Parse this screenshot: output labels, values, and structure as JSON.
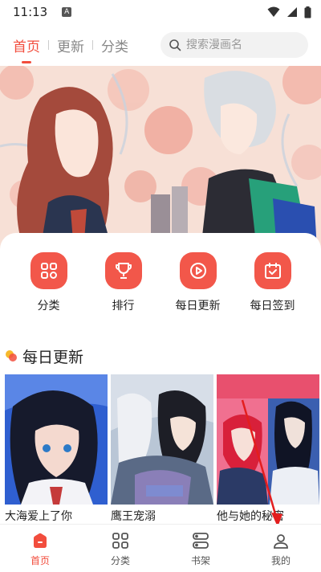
{
  "status_bar": {
    "time": "11:13",
    "notif_letter": "A"
  },
  "top_nav": {
    "tabs": [
      {
        "label": "首页",
        "active": true
      },
      {
        "label": "更新",
        "active": false
      },
      {
        "label": "分类",
        "active": false
      }
    ],
    "search_placeholder": "搜索漫画名"
  },
  "shortcuts": [
    {
      "label": "分类",
      "icon": "category-grid-icon"
    },
    {
      "label": "排行",
      "icon": "trophy-icon"
    },
    {
      "label": "每日更新",
      "icon": "play-circle-icon"
    },
    {
      "label": "每日签到",
      "icon": "calendar-check-icon"
    }
  ],
  "section": {
    "title": "每日更新"
  },
  "comics": [
    {
      "title": "大海爱上了你"
    },
    {
      "title": "鹰王宠溺"
    },
    {
      "title": "他与她的秘密"
    }
  ],
  "bottom_nav": [
    {
      "label": "首页",
      "icon": "home-icon",
      "active": true
    },
    {
      "label": "分类",
      "icon": "grid-icon",
      "active": false
    },
    {
      "label": "书架",
      "icon": "bookshelf-icon",
      "active": false
    },
    {
      "label": "我的",
      "icon": "profile-icon",
      "active": false
    }
  ],
  "colors": {
    "accent": "#f24d3d",
    "icon_bg": "#f2574a"
  }
}
